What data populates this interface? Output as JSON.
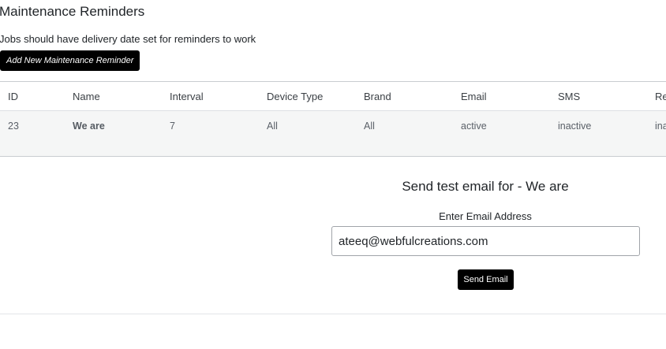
{
  "page": {
    "title": "Maintenance Reminders",
    "subtitle": "Jobs should have delivery date set for reminders to work",
    "add_button_label": "Add New Maintenance Reminder"
  },
  "table": {
    "headers": [
      "ID",
      "Name",
      "Interval",
      "Device Type",
      "Brand",
      "Email",
      "SMS",
      "Re"
    ],
    "rows": [
      {
        "id": "23",
        "name": "We are",
        "interval": "7",
        "device_type": "All",
        "brand": "All",
        "email": "active",
        "sms": "inactive",
        "reminder": "ina"
      }
    ]
  },
  "test_email": {
    "title": "Send test email for - We are",
    "label": "Enter Email Address",
    "value": "ateeq@webfulcreations.com",
    "button_label": "Send Email"
  },
  "colors": {
    "button_bg": "#000000",
    "row_bg": "#f5f6f6"
  }
}
